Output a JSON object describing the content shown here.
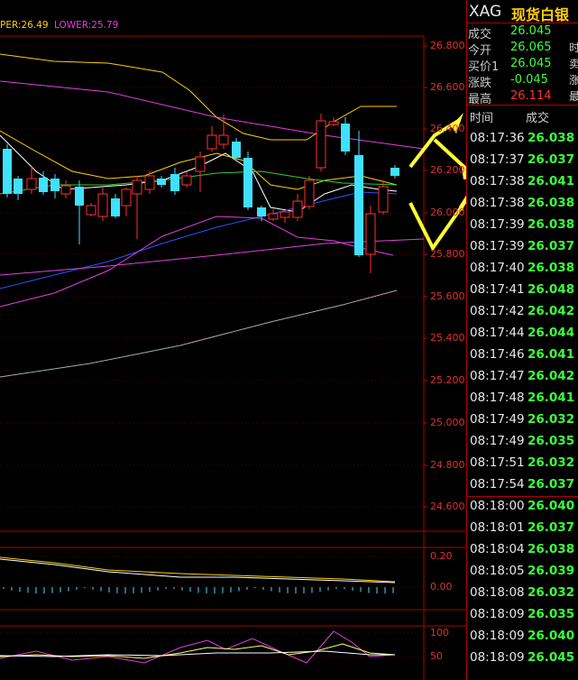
{
  "legend": {
    "upper": "PER:26.49",
    "lower": "LOWER:25.79"
  },
  "axis": {
    "main": [
      "26.800",
      "26.600",
      "26.400",
      "26.200",
      "26.000",
      "25.800",
      "25.600",
      "25.400",
      "25.200",
      "25.000",
      "24.800",
      "24.600"
    ],
    "macd": [
      "0.20",
      "0.00"
    ],
    "kdj": [
      "100",
      "50"
    ]
  },
  "panel": {
    "symbol": "XAG",
    "name": "现货白银",
    "quote": [
      {
        "label": "成交",
        "value": "26.045"
      },
      {
        "label": "今开",
        "value": "26.065"
      },
      {
        "label": "买价1",
        "value": "26.045"
      },
      {
        "label": "涨跌",
        "value": "-0.045"
      },
      {
        "label": "最高",
        "value": "26.114"
      }
    ],
    "edge_labels": [
      "时",
      "卖",
      "涨",
      "最"
    ],
    "ticks_header": {
      "time": "时间",
      "price": "成交"
    },
    "ticks": [
      {
        "time": "08:17:36",
        "price": "26.038"
      },
      {
        "time": "08:17:37",
        "price": "26.037"
      },
      {
        "time": "08:17:38",
        "price": "26.041"
      },
      {
        "time": "08:17:38",
        "price": "26.038"
      },
      {
        "time": "08:17:39",
        "price": "26.038"
      },
      {
        "time": "08:17:39",
        "price": "26.037"
      },
      {
        "time": "08:17:40",
        "price": "26.038"
      },
      {
        "time": "08:17:41",
        "price": "26.048"
      },
      {
        "time": "08:17:42",
        "price": "26.042"
      },
      {
        "time": "08:17:44",
        "price": "26.044"
      },
      {
        "time": "08:17:46",
        "price": "26.041"
      },
      {
        "time": "08:17:47",
        "price": "26.042"
      },
      {
        "time": "08:17:48",
        "price": "26.041"
      },
      {
        "time": "08:17:49",
        "price": "26.032"
      },
      {
        "time": "08:17:49",
        "price": "26.035"
      },
      {
        "time": "08:17:51",
        "price": "26.032"
      },
      {
        "time": "08:17:54",
        "price": "26.037"
      },
      {
        "time": "08:18:00",
        "price": "26.040"
      },
      {
        "time": "08:18:01",
        "price": "26.037"
      },
      {
        "time": "08:18:04",
        "price": "26.038"
      },
      {
        "time": "08:18:05",
        "price": "26.039"
      },
      {
        "time": "08:18:08",
        "price": "26.032"
      },
      {
        "time": "08:18:09",
        "price": "26.035"
      },
      {
        "time": "08:18:09",
        "price": "26.040"
      },
      {
        "time": "08:18:09",
        "price": "26.045"
      }
    ]
  },
  "colors": {
    "up": "#ff3030",
    "down": "#40e0ff",
    "grid": "#7a0000",
    "axis": "#e03030",
    "price_green": "#3cff3c",
    "title_yellow": "#ffd000",
    "annotation": "#ffff33"
  }
}
